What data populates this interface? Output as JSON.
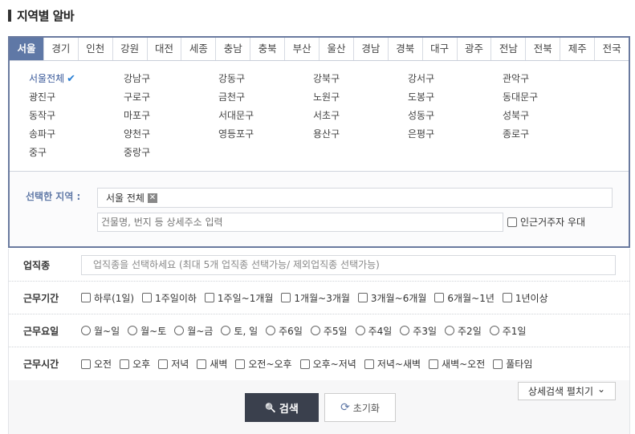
{
  "page": {
    "title": "지역별 알바"
  },
  "regions": {
    "tabs": [
      "서울",
      "경기",
      "인천",
      "강원",
      "대전",
      "세종",
      "충남",
      "충북",
      "부산",
      "울산",
      "경남",
      "경북",
      "대구",
      "광주",
      "전남",
      "전북",
      "제주",
      "전국"
    ],
    "active": "서울",
    "districts": [
      "서울전체",
      "강남구",
      "강동구",
      "강북구",
      "강서구",
      "관악구",
      "광진구",
      "구로구",
      "금천구",
      "노원구",
      "도봉구",
      "동대문구",
      "동작구",
      "마포구",
      "서대문구",
      "서초구",
      "성동구",
      "성북구",
      "송파구",
      "양천구",
      "영등포구",
      "용산구",
      "은평구",
      "종로구",
      "중구",
      "중랑구"
    ],
    "selected_district": "서울전체",
    "check_icon": "✔"
  },
  "selected": {
    "label": "선택한 지역 :",
    "chip": "서울 전체",
    "chip_remove": "✕",
    "address_placeholder": "건물명, 번지 등 상세주소 입력",
    "near_label": "인근거주자 우대"
  },
  "job_type": {
    "label": "업직종",
    "placeholder": "업직종을 선택하세요 (최대 5개 업직종 선택가능/ 제외업직종 선택가능)"
  },
  "period": {
    "label": "근무기간",
    "options": [
      "하루(1일)",
      "1주일이하",
      "1주일~1개월",
      "1개월~3개월",
      "3개월~6개월",
      "6개월~1년",
      "1년이상"
    ]
  },
  "days": {
    "label": "근무요일",
    "options": [
      "월~일",
      "월~토",
      "월~금",
      "토, 일",
      "주6일",
      "주5일",
      "주4일",
      "주3일",
      "주2일",
      "주1일"
    ]
  },
  "hours": {
    "label": "근무시간",
    "options": [
      "오전",
      "오후",
      "저녁",
      "새벽",
      "오전~오후",
      "오후~저녁",
      "저녁~새벽",
      "새벽~오전",
      "풀타임"
    ]
  },
  "actions": {
    "detail_toggle": "상세검색 펼치기",
    "detail_icon": "⌄",
    "search": "검색",
    "search_icon": "🔍",
    "reset": "초기화",
    "reset_icon": "⟳"
  }
}
